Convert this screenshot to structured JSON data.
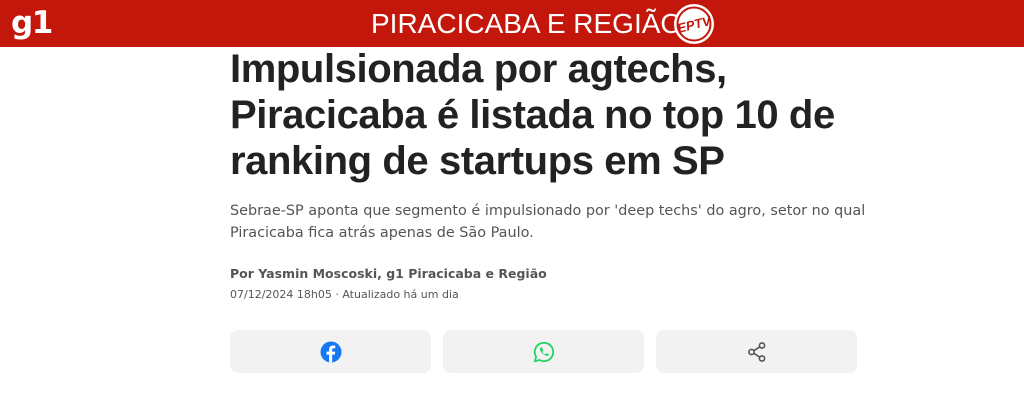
{
  "header": {
    "logo": "g1",
    "section": "PIRACICABA E REGIÃO",
    "affiliate_logo_text": "EPTV",
    "bar_color": "#c4170c"
  },
  "article": {
    "headline_lines": [
      "Impulsionada por agtechs,",
      "Piracicaba é listada no top 10 de",
      "ranking de startups em SP"
    ],
    "subtitle_lines": [
      "Sebrae-SP aponta que segmento é impulsionado por 'deep techs' do agro, setor no qual",
      "Piracicaba fica atrás apenas de São Paulo."
    ],
    "byline": "Por Yasmin Moscoski, g1 Piracicaba e Região",
    "dateline": "07/12/2024 18h05 · Atualizado há um dia"
  },
  "share_buttons": [
    {
      "icon": "facebook-icon",
      "color": "#1877f2"
    },
    {
      "icon": "whatsapp-icon",
      "color": "#25d366"
    },
    {
      "icon": "share-icon",
      "color": "#555555"
    }
  ]
}
